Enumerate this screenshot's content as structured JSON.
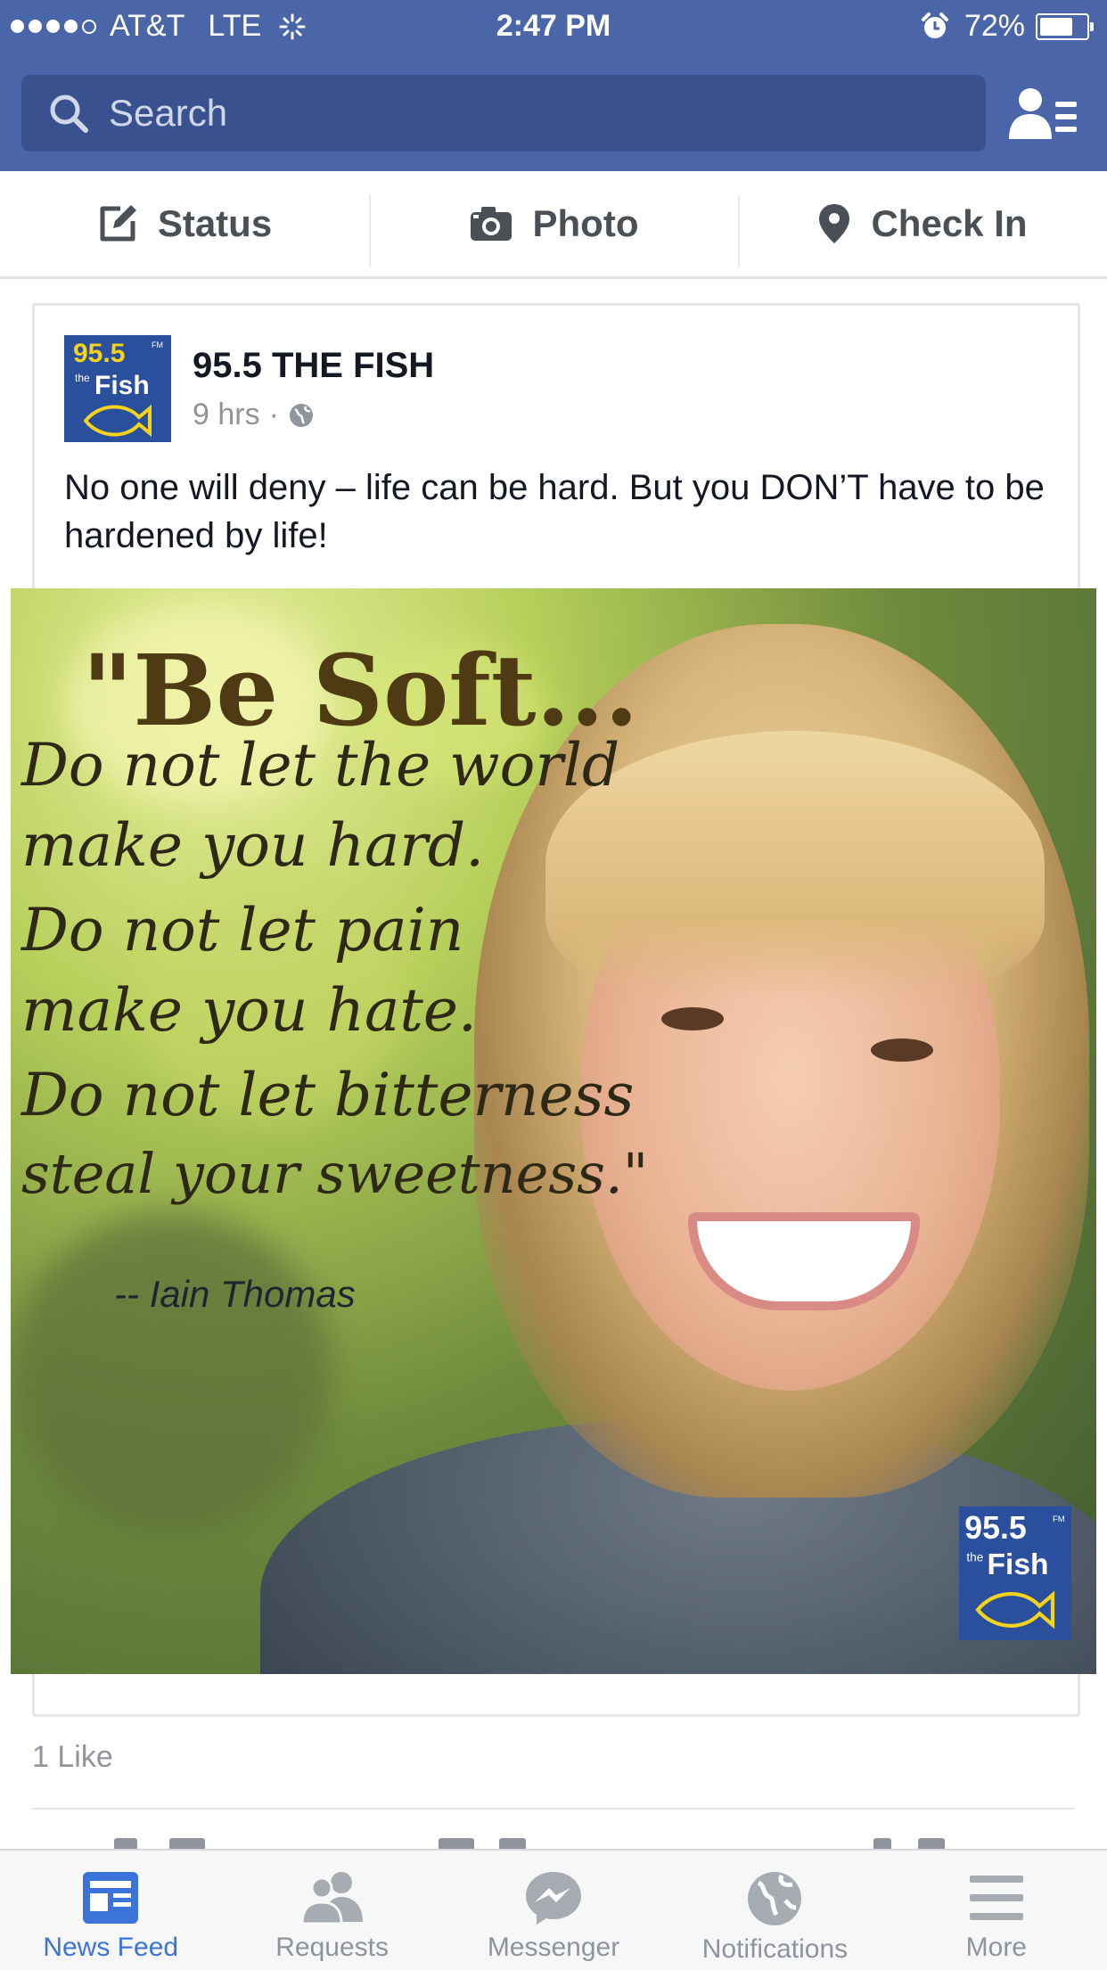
{
  "status_bar": {
    "carrier": "AT&T",
    "network": "LTE",
    "time": "2:47 PM",
    "battery_percent": "72%",
    "battery_level": 0.72
  },
  "search": {
    "placeholder": "Search"
  },
  "composer": {
    "status_label": "Status",
    "photo_label": "Photo",
    "checkin_label": "Check In"
  },
  "post": {
    "author": "95.5 THE FISH",
    "time": "9 hrs",
    "separator": "·",
    "text": "No one will deny – life can be hard.  But you DON’T have to be hardened by life!",
    "image": {
      "title": "\"Be Soft...",
      "lines": [
        "Do not let the world",
        "make you hard.",
        "Do not let pain",
        "make you hate.",
        "Do not let bitterness",
        "steal your sweetness.\""
      ],
      "author": "-- Iain Thomas"
    },
    "logo": {
      "number": "95.5",
      "fm": "FM",
      "the": "the",
      "fish": "Fish"
    },
    "likes": "1 Like"
  },
  "tabs": [
    {
      "label": "News Feed",
      "icon": "news-feed-icon",
      "active": true
    },
    {
      "label": "Requests",
      "icon": "requests-icon",
      "active": false
    },
    {
      "label": "Messenger",
      "icon": "messenger-icon",
      "active": false
    },
    {
      "label": "Notifications",
      "icon": "globe-icon",
      "active": false
    },
    {
      "label": "More",
      "icon": "menu-icon",
      "active": false
    }
  ],
  "colors": {
    "header_blue": "#4a66a8",
    "active_tab": "#3b73db",
    "logo_yellow": "#f3d31c",
    "logo_blue": "#2a4f9d"
  }
}
